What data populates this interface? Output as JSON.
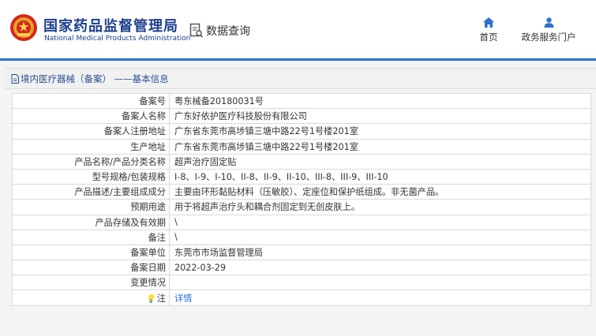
{
  "header": {
    "title_cn": "国家药品监督管理局",
    "title_en": "National Medical Products Administration",
    "query_label": "数据查询",
    "nav": [
      {
        "label": "首页",
        "icon": "home-icon"
      },
      {
        "label": "政务服务门户",
        "icon": "user-icon"
      }
    ]
  },
  "breadcrumb": {
    "text": "境内医疗器械（备案） ——基本信息"
  },
  "details": [
    {
      "label": "备案号",
      "value": "粤东械备20180031号"
    },
    {
      "label": "备案人名称",
      "value": "广东好依护医疗科技股份有限公司"
    },
    {
      "label": "备案人注册地址",
      "value": "广东省东莞市高埗镇三塘中路22号1号楼201室"
    },
    {
      "label": "生产地址",
      "value": "广东省东莞市高埗镇三塘中路22号1号楼201室"
    },
    {
      "label": "产品名称/产品分类名称",
      "value": "超声治疗固定贴"
    },
    {
      "label": "型号规格/包装规格",
      "value": "I-8、I-9、I-10、II-8、II-9、II-10、III-8、III-9、III-10"
    },
    {
      "label": "产品描述/主要组成成分",
      "value": "主要由环形黏贴材料（压敏胶）、定座位和保护纸组成。非无菌产品。"
    },
    {
      "label": "预期用途",
      "value": "用于将超声治疗头和耦合剂固定到无创皮肤上。"
    },
    {
      "label": "产品存储及有效期",
      "value": "\\"
    },
    {
      "label": "备注",
      "value": "\\"
    },
    {
      "label": "备案单位",
      "value": "东莞市市场监督管理局"
    },
    {
      "label": "备案日期",
      "value": "2022-03-29"
    },
    {
      "label": "变更情况",
      "value": ""
    }
  ],
  "note_row": {
    "label": "注",
    "link": "详情"
  },
  "colors": {
    "brand": "#1d3f8f",
    "accent": "#2f6fd1"
  }
}
